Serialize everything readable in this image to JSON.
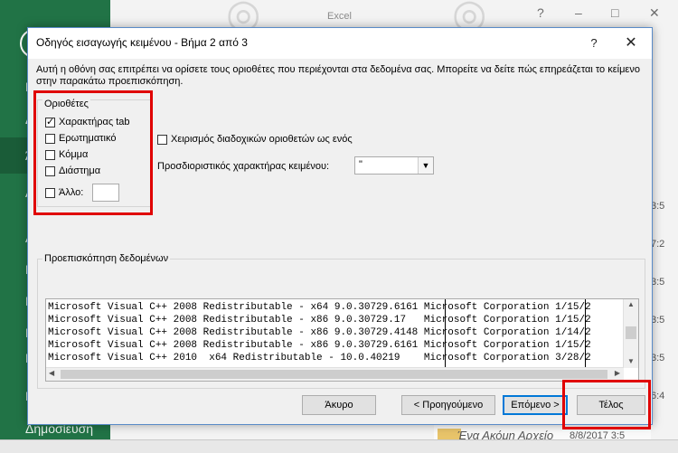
{
  "excel": {
    "title": "Excel",
    "left_nav": [
      "Π",
      "Δ",
      "Ά",
      "Α",
      "Α",
      "Ε",
      "Ε",
      "Ε",
      "Κ",
      "Ε",
      "Ε",
      "Ε",
      "Δημοσίευση"
    ],
    "right_times": [
      "3:5",
      "7:2",
      "3:5",
      "3:5",
      "3:5",
      "3:5",
      "6:4"
    ],
    "bottom_file_name": "Ένα Ακόμη Αρχείο",
    "bottom_file_date": "8/8/2017 3:5",
    "window_controls": [
      "?",
      "–",
      "□",
      "✕"
    ]
  },
  "dialog": {
    "title": "Οδηγός εισαγωγής κειμένου - Βήμα 2 από 3",
    "help": "?",
    "close": "✕",
    "description": "Αυτή η οθόνη σας επιτρέπει να ορίσετε τους οριοθέτες που περιέχονται στα δεδομένα σας.  Μπορείτε να δείτε πώς επηρεάζεται το κείμενο στην παρακάτω προεπισκόπηση.",
    "delimiters": {
      "label": "Οριοθέτες",
      "tab": {
        "label": "Χαρακτήρας tab",
        "checked": true
      },
      "semicolon": {
        "label": "Ερωτηματικό",
        "checked": false
      },
      "comma": {
        "label": "Κόμμα",
        "checked": false
      },
      "space": {
        "label": "Διάστημα",
        "checked": false
      },
      "other": {
        "label": "Άλλο:",
        "checked": false,
        "value": ""
      }
    },
    "consecutive": {
      "label": "Χειρισμός διαδοχικών οριοθετών ως ενός",
      "checked": false
    },
    "qualifier": {
      "label": "Προσδιοριστικός χαρακτήρας κειμένου:",
      "value": "\""
    },
    "preview": {
      "label": "Προεπισκόπηση δεδομένων",
      "rows": [
        "Microsoft Visual C++ 2008 Redistributable - x64 9.0.30729.6161 Microsoft Corporation 1/15/2",
        "Microsoft Visual C++ 2008 Redistributable - x86 9.0.30729.17   Microsoft Corporation 1/15/2",
        "Microsoft Visual C++ 2008 Redistributable - x86 9.0.30729.4148 Microsoft Corporation 1/14/2",
        "Microsoft Visual C++ 2008 Redistributable - x86 9.0.30729.6161 Microsoft Corporation 1/15/2",
        "Microsoft Visual C++ 2010  x64 Redistributable - 10.0.40219    Microsoft Corporation 3/28/2"
      ]
    },
    "buttons": {
      "cancel": "Άκυρο",
      "back": "< Προηγούμενο",
      "next": "Επόμενο >",
      "finish": "Τέλος"
    }
  }
}
